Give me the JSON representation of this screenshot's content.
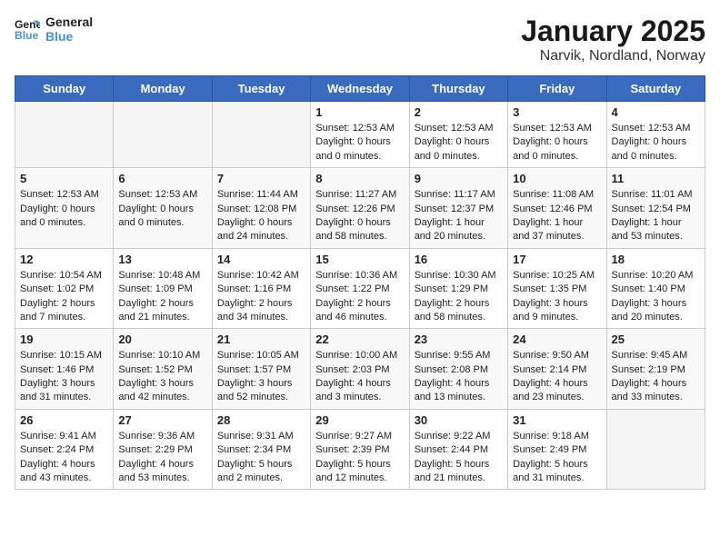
{
  "header": {
    "logo_line1": "General",
    "logo_line2": "Blue",
    "title": "January 2025",
    "subtitle": "Narvik, Nordland, Norway"
  },
  "weekdays": [
    "Sunday",
    "Monday",
    "Tuesday",
    "Wednesday",
    "Thursday",
    "Friday",
    "Saturday"
  ],
  "weeks": [
    [
      {
        "day": "",
        "info": ""
      },
      {
        "day": "",
        "info": ""
      },
      {
        "day": "",
        "info": ""
      },
      {
        "day": "1",
        "info": "Sunset: 12:53 AM\nDaylight: 0 hours and 0 minutes."
      },
      {
        "day": "2",
        "info": "Sunset: 12:53 AM\nDaylight: 0 hours and 0 minutes."
      },
      {
        "day": "3",
        "info": "Sunset: 12:53 AM\nDaylight: 0 hours and 0 minutes."
      },
      {
        "day": "4",
        "info": "Sunset: 12:53 AM\nDaylight: 0 hours and 0 minutes."
      }
    ],
    [
      {
        "day": "5",
        "info": "Sunset: 12:53 AM\nDaylight: 0 hours and 0 minutes."
      },
      {
        "day": "6",
        "info": "Sunset: 12:53 AM\nDaylight: 0 hours and 0 minutes."
      },
      {
        "day": "7",
        "info": "Sunrise: 11:44 AM\nSunset: 12:08 PM\nDaylight: 0 hours and 24 minutes."
      },
      {
        "day": "8",
        "info": "Sunrise: 11:27 AM\nSunset: 12:26 PM\nDaylight: 0 hours and 58 minutes."
      },
      {
        "day": "9",
        "info": "Sunrise: 11:17 AM\nSunset: 12:37 PM\nDaylight: 1 hour and 20 minutes."
      },
      {
        "day": "10",
        "info": "Sunrise: 11:08 AM\nSunset: 12:46 PM\nDaylight: 1 hour and 37 minutes."
      },
      {
        "day": "11",
        "info": "Sunrise: 11:01 AM\nSunset: 12:54 PM\nDaylight: 1 hour and 53 minutes."
      }
    ],
    [
      {
        "day": "12",
        "info": "Sunrise: 10:54 AM\nSunset: 1:02 PM\nDaylight: 2 hours and 7 minutes."
      },
      {
        "day": "13",
        "info": "Sunrise: 10:48 AM\nSunset: 1:09 PM\nDaylight: 2 hours and 21 minutes."
      },
      {
        "day": "14",
        "info": "Sunrise: 10:42 AM\nSunset: 1:16 PM\nDaylight: 2 hours and 34 minutes."
      },
      {
        "day": "15",
        "info": "Sunrise: 10:36 AM\nSunset: 1:22 PM\nDaylight: 2 hours and 46 minutes."
      },
      {
        "day": "16",
        "info": "Sunrise: 10:30 AM\nSunset: 1:29 PM\nDaylight: 2 hours and 58 minutes."
      },
      {
        "day": "17",
        "info": "Sunrise: 10:25 AM\nSunset: 1:35 PM\nDaylight: 3 hours and 9 minutes."
      },
      {
        "day": "18",
        "info": "Sunrise: 10:20 AM\nSunset: 1:40 PM\nDaylight: 3 hours and 20 minutes."
      }
    ],
    [
      {
        "day": "19",
        "info": "Sunrise: 10:15 AM\nSunset: 1:46 PM\nDaylight: 3 hours and 31 minutes."
      },
      {
        "day": "20",
        "info": "Sunrise: 10:10 AM\nSunset: 1:52 PM\nDaylight: 3 hours and 42 minutes."
      },
      {
        "day": "21",
        "info": "Sunrise: 10:05 AM\nSunset: 1:57 PM\nDaylight: 3 hours and 52 minutes."
      },
      {
        "day": "22",
        "info": "Sunrise: 10:00 AM\nSunset: 2:03 PM\nDaylight: 4 hours and 3 minutes."
      },
      {
        "day": "23",
        "info": "Sunrise: 9:55 AM\nSunset: 2:08 PM\nDaylight: 4 hours and 13 minutes."
      },
      {
        "day": "24",
        "info": "Sunrise: 9:50 AM\nSunset: 2:14 PM\nDaylight: 4 hours and 23 minutes."
      },
      {
        "day": "25",
        "info": "Sunrise: 9:45 AM\nSunset: 2:19 PM\nDaylight: 4 hours and 33 minutes."
      }
    ],
    [
      {
        "day": "26",
        "info": "Sunrise: 9:41 AM\nSunset: 2:24 PM\nDaylight: 4 hours and 43 minutes."
      },
      {
        "day": "27",
        "info": "Sunrise: 9:36 AM\nSunset: 2:29 PM\nDaylight: 4 hours and 53 minutes."
      },
      {
        "day": "28",
        "info": "Sunrise: 9:31 AM\nSunset: 2:34 PM\nDaylight: 5 hours and 2 minutes."
      },
      {
        "day": "29",
        "info": "Sunrise: 9:27 AM\nSunset: 2:39 PM\nDaylight: 5 hours and 12 minutes."
      },
      {
        "day": "30",
        "info": "Sunrise: 9:22 AM\nSunset: 2:44 PM\nDaylight: 5 hours and 21 minutes."
      },
      {
        "day": "31",
        "info": "Sunrise: 9:18 AM\nSunset: 2:49 PM\nDaylight: 5 hours and 31 minutes."
      },
      {
        "day": "",
        "info": ""
      }
    ]
  ]
}
